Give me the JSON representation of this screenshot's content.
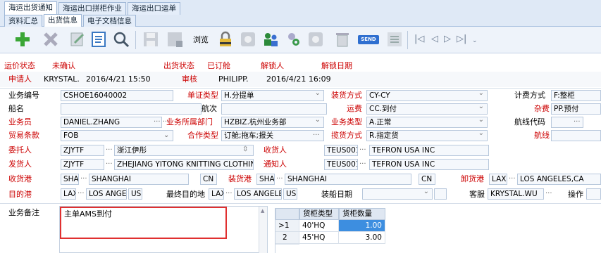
{
  "top_tabs": [
    {
      "label": "海运出货通知",
      "active": true
    },
    {
      "label": "海运出口拼柜作业",
      "active": false
    },
    {
      "label": "海运出口运单",
      "active": false
    }
  ],
  "sub_tabs": [
    {
      "label": "资料汇总",
      "active": false
    },
    {
      "label": "出货信息",
      "active": true
    },
    {
      "label": "电子文档信息",
      "active": false
    }
  ],
  "toolbar": {
    "browse_label": "浏览",
    "send_label": "SEND",
    "icons": [
      "add-icon",
      "delete-icon",
      "edit-icon",
      "document-icon",
      "search-icon",
      "save-icon",
      "save-disabled-icon",
      "lock-icon",
      "disabled-circle-icon",
      "users-icon",
      "user-settings-icon",
      "disabled-circle-icon",
      "trash-icon",
      "send-icon",
      "list-icon",
      "first-icon",
      "prev-icon",
      "next-icon",
      "last-icon"
    ]
  },
  "status_row": {
    "status_label": "运价状态",
    "status_value": "未确认",
    "ship_status_label": "出货状态",
    "ship_status_value": "已订舱",
    "unlocker_label": "解锁人",
    "unlock_date_label": "解锁日期"
  },
  "applicant_row": {
    "applicant_label": "申请人",
    "applicant_value": "KRYSTAL.",
    "applicant_date": "2016/4/21 15:50",
    "review_label": "审核",
    "review_value": "PHILIPP.",
    "review_date": "2016/4/21 16:09"
  },
  "form": {
    "biz_no_label": "业务编号",
    "biz_no": "CSHOE16040002",
    "bill_type_label": "单证类型",
    "bill_type": "H.分提单",
    "load_mode_label": "装货方式",
    "load_mode": "CY-CY",
    "charge_mode_label": "计费方式",
    "charge_mode": "F:整柜",
    "vessel_label": "船名",
    "voyage_label": "航次",
    "freight_label": "运费",
    "freight": "CC.到付",
    "misc_label": "杂费",
    "misc": "PP.预付",
    "salesman_label": "业务员",
    "salesman": "DANIEL.ZHANG",
    "dept_label": "业务所属部门",
    "dept": "HZBIZ.杭州业务部",
    "biz_type_label": "业务类型",
    "biz_type": "A.正常",
    "route_code_label": "航线代码",
    "trade_terms_label": "贸易条款",
    "trade_terms": "FOB",
    "coop_type_label": "合作类型",
    "coop_type": "订舱;拖车;报关",
    "solicit_label": "揽货方式",
    "solicit": "R.指定货",
    "route_label": "航线",
    "consignor_label": "委托人",
    "consignor_code": "ZJYTF",
    "consignor_name": "浙江伊彤",
    "consignee_label": "收货人",
    "consignee_code": "TEUS001",
    "consignee_name": "TEFRON USA INC",
    "shipper_label": "发货人",
    "shipper_code": "ZJYTF",
    "shipper_name": "ZHEJIANG YITONG KNITTING CLOTHING",
    "notify_label": "通知人",
    "notify_code": "TEUS001",
    "notify_name": "TEFRON USA INC",
    "receipt_port_label": "收货港",
    "receipt_code": "SHA",
    "receipt_name": "SHANGHAI",
    "receipt_country": "CN",
    "loading_port_label": "装货港",
    "loading_code": "SHA",
    "loading_name": "SHANGHAI",
    "loading_country": "CN",
    "discharge_port_label": "卸货港",
    "discharge_code": "LAX",
    "discharge_name": "LOS ANGELES,CA",
    "dest_port_label": "目的港",
    "dest_code": "LAX",
    "dest_name": "LOS ANGELE",
    "dest_country": "US",
    "final_dest_label": "最终目的地",
    "final_code": "LAX",
    "final_name": "LOS ANGELE",
    "final_country": "US",
    "ship_date_label": "装船日期",
    "cs_label": "客服",
    "cs": "KRYSTAL.WU",
    "op_label": "操作"
  },
  "remarks": {
    "label": "业务备注",
    "text": "主单AMS到付"
  },
  "container_grid": {
    "headers": [
      "货柜类型",
      "货柜数量"
    ],
    "rows": [
      {
        "idx": "1",
        "type": "40'HQ",
        "qty": "1.00",
        "selected": true
      },
      {
        "idx": "2",
        "type": "45'HQ",
        "qty": "3.00",
        "selected": false
      }
    ]
  },
  "colors": {
    "label_red": "#cc0000",
    "highlight_box": "#e03030",
    "selected_cell": "#3d8ee0"
  }
}
